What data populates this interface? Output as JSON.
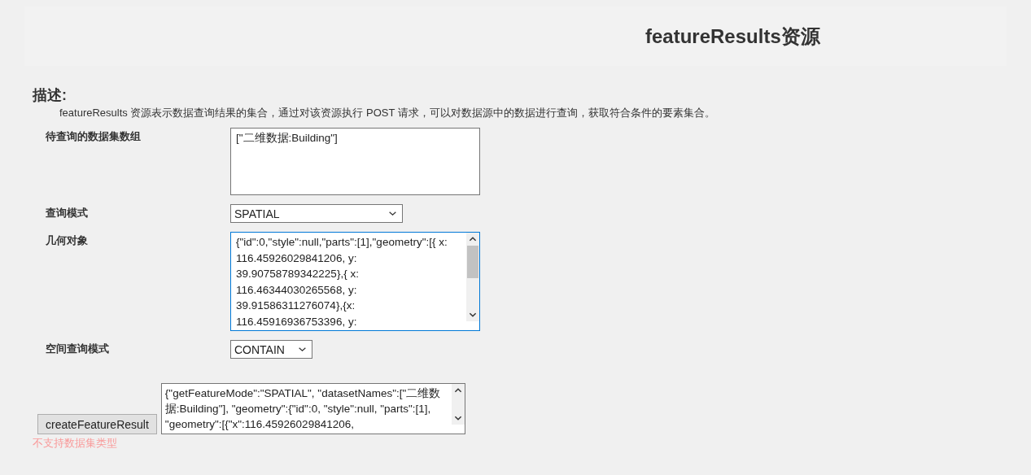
{
  "title": "featureResults资源",
  "description": {
    "heading": "描述:",
    "text": "featureResults 资源表示数据查询结果的集合，通过对该资源执行 POST 请求，可以对数据源中的数据进行查询，获取符合条件的要素集合。"
  },
  "fields": [
    {
      "kind": "textarea",
      "label": "待查询的数据集数组",
      "value": "[\"二维数据:Building\"]",
      "focused": false,
      "scrollbar": false
    },
    {
      "kind": "select",
      "label": "查询模式",
      "value": "SPATIAL"
    },
    {
      "kind": "textarea",
      "label": "几何对象",
      "value": "{\"id\":0,\"style\":null,\"parts\":[1],\"geometry\":[{ x: 116.45926029841206, y: 39.90758789342225},{ x: 116.46344030265568, y: 39.91586311276074},{x: 116.45916936753396, y:",
      "focused": true,
      "scrollbar": true
    },
    {
      "kind": "select",
      "label": "空间查询模式",
      "value": "CONTAIN"
    }
  ],
  "submit": {
    "label": "createFeatureResult",
    "request": "{\"getFeatureMode\":\"SPATIAL\", \"datasetNames\":[\"二维数据:Building\"], \"geometry\":{\"id\":0, \"style\":null, \"parts\":[1], \"geometry\":[{\"x\":116.45926029841206,"
  },
  "error": "不支持数据集类型"
}
